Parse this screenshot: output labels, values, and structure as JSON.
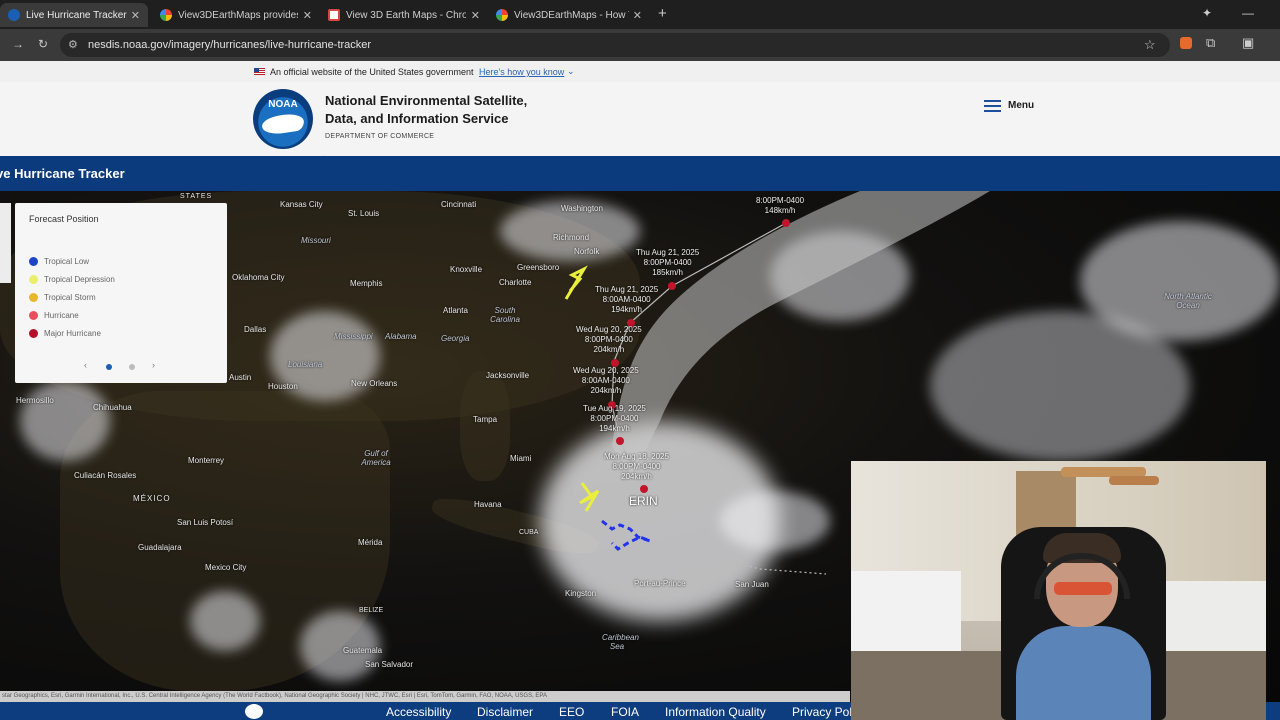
{
  "browser": {
    "tabs": [
      {
        "label": "Live Hurricane Tracker | NESDIS",
        "favicon_color": "#1a5fb4",
        "active": true
      },
      {
        "label": "View3DEarthMaps provides yo",
        "favicon_color": "#ea4335",
        "active": false
      },
      {
        "label": "View 3D Earth Maps - Chrome",
        "favicon_color": "#d44",
        "active": false
      },
      {
        "label": "View3DEarthMaps - How To Us",
        "favicon_color": "#ea4335",
        "active": false
      }
    ],
    "new_tab": "+",
    "close_glyph": "✕",
    "url": "nesdis.noaa.gov/imagery/hurricanes/live-hurricane-tracker"
  },
  "gov_banner": {
    "text": "An official website of the United States government",
    "link": "Here's how you know"
  },
  "header": {
    "logo_text": "NOAA",
    "org_line1": "National Environmental Satellite,",
    "org_line2": "Data, and Information Service",
    "dept": "DEPARTMENT OF COMMERCE",
    "menu_label": "Menu"
  },
  "page_title": "ve Hurricane Tracker",
  "legend": {
    "title": "Forecast Position",
    "items": [
      {
        "label": "Tropical Low",
        "color": "#1c44c7"
      },
      {
        "label": "Tropical Depression",
        "color": "#e9ef6a"
      },
      {
        "label": "Tropical Storm",
        "color": "#e9b62a"
      },
      {
        "label": "Hurricane",
        "color": "#e74f5d"
      },
      {
        "label": "Major Hurricane",
        "color": "#b3102a"
      }
    ],
    "prev": "‹",
    "next": "›"
  },
  "storm": {
    "name": "ERIN",
    "advisories": [
      {
        "date": "Mon Aug 18, 2025",
        "time": "8:00PM-0400",
        "speed": "204km/h"
      },
      {
        "date": "Tue Aug 19, 2025",
        "time": "8:00PM-0400",
        "speed": "194km/h"
      },
      {
        "date": "Wed Aug 20, 2025",
        "time": "8:00AM-0400",
        "speed": "204km/h"
      },
      {
        "date": "Wed Aug 20, 2025",
        "time": "8:00PM-0400",
        "speed": "204km/h"
      },
      {
        "date": "Thu Aug 21, 2025",
        "time": "8:00AM-0400",
        "speed": "194km/h"
      },
      {
        "date": "Thu Aug 21, 2025",
        "time": "8:00PM-0400",
        "speed": "185km/h"
      },
      {
        "date": "",
        "time": "8:00PM-0400",
        "speed": "148km/h"
      }
    ]
  },
  "map_labels": {
    "states": "STATES",
    "kansas_city": "Kansas City",
    "st_louis": "St. Louis",
    "cincinnati": "Cincinnati",
    "washington": "Washington",
    "missouri": "Missouri",
    "richmond": "Richmond",
    "norfolk": "Norfolk",
    "oklahoma_city": "Oklahoma City",
    "memphis": "Memphis",
    "knoxville": "Knoxville",
    "greensboro": "Greensboro",
    "charlotte": "Charlotte",
    "atlanta": "Atlanta",
    "south_carolina": "South Carolina",
    "dallas": "Dallas",
    "mississippi": "Mississippi",
    "alabama": "Alabama",
    "georgia": "Georgia",
    "louisiana": "Louisiana",
    "austin": "Austin",
    "houston": "Houston",
    "new_orleans": "New Orleans",
    "jacksonville": "Jacksonville",
    "hermosillo": "Hermosillo",
    "chihuahua": "Chihuahua",
    "tampa": "Tampa",
    "gulf": "Gulf of America",
    "monterrey": "Monterrey",
    "miami": "Miami",
    "culiacan": "Culiacán Rosales",
    "mexico": "MÉXICO",
    "havana": "Havana",
    "cuba": "CUBA",
    "san_luis": "San Luis Potosí",
    "guadalajara": "Guadalajara",
    "merida": "Mérida",
    "port_au_prince": "Port-au-Prince",
    "san_juan": "San Juan",
    "mexico_city": "Mexico City",
    "kingston": "Kingston",
    "belize": "BELIZE",
    "caribbean": "Caribbean Sea",
    "guatemala": "Guatemala",
    "san_salvador": "San Salvador",
    "north_atlantic": "North Atlantic Ocean"
  },
  "attribution": "star Geographics, Esri, Garmin International, Inc., U.S. Central Intelligence Agency (The World Factbook), National Geographic Society | NHC, JTWC, Esri | Esri, TomTom, Garmin, FAO, NOAA, USGS, EPA",
  "footer": {
    "links": [
      "Accessibility",
      "Disclaimer",
      "EEO",
      "FOIA",
      "Information Quality",
      "Privacy Pol"
    ]
  }
}
